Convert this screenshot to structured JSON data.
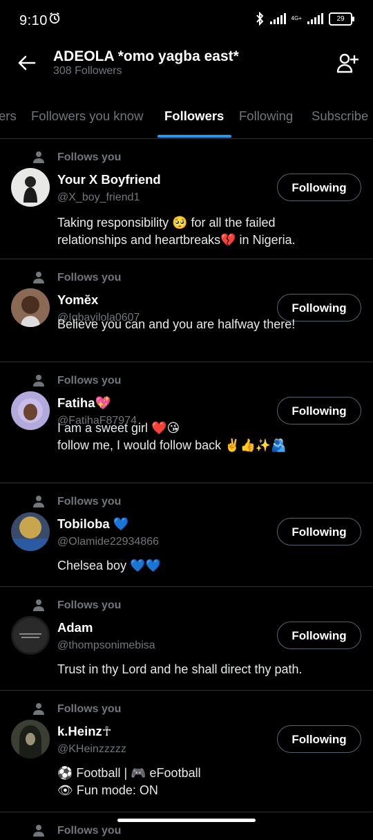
{
  "status_bar": {
    "time": "9:10",
    "network": "4G+",
    "battery": "29"
  },
  "header": {
    "title": "ADEOLA *omo yagba east*",
    "subtitle": "308 Followers"
  },
  "tabs": [
    {
      "label": "ers"
    },
    {
      "label": "Followers you know"
    },
    {
      "label": "Followers",
      "active": true
    },
    {
      "label": "Following"
    },
    {
      "label": "Subscribe"
    }
  ],
  "follows_label": "Follows you",
  "button_label": "Following",
  "accounts": [
    {
      "name": "Your X Boyfriend",
      "handle": "@X_boy_friend1",
      "bio": "Taking responsibility 🥺 for all the failed\nrelationships and heartbreaks💔 in Nigeria."
    },
    {
      "name": "Yomĕx",
      "handle": "@Igbayilola0607",
      "bio": "Believe you can and you are halfway there!"
    },
    {
      "name": "Fatiha💖",
      "handle": "@FatihaF87974",
      "bio": "I am a sweet girl ❤️😘\nfollow me, I would follow back ✌️👍✨🫂"
    },
    {
      "name": "Tobiloba 💙",
      "handle": "@Olamide22934866",
      "bio": "Chelsea boy 💙💙"
    },
    {
      "name": "Adam",
      "handle": "@thompsonimebisa",
      "bio": "Trust in thy Lord and he shall direct thy path."
    },
    {
      "name": "k.Heinz☥",
      "handle": "@KHeinzzzzz",
      "bio": "⚽ Football | 🎮 eFootball\n👁 Fun mode: ON"
    }
  ],
  "colors": {
    "accent": "#1d9bf0",
    "muted": "#71767b",
    "divider": "#2f3336"
  }
}
